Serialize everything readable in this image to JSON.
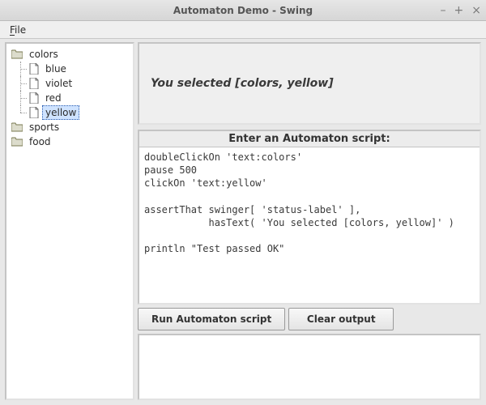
{
  "window": {
    "title": "Automaton Demo - Swing",
    "controls": {
      "minimize": "–",
      "maximize": "+",
      "close": "×"
    }
  },
  "menubar": {
    "file": {
      "label": "File",
      "underline_index": 0
    }
  },
  "tree": {
    "nodes": [
      {
        "kind": "folder",
        "label": "colors",
        "expanded": true,
        "level": 0
      },
      {
        "kind": "file",
        "label": "blue",
        "level": 1,
        "last": false
      },
      {
        "kind": "file",
        "label": "violet",
        "level": 1,
        "last": false
      },
      {
        "kind": "file",
        "label": "red",
        "level": 1,
        "last": false
      },
      {
        "kind": "file",
        "label": "yellow",
        "level": 1,
        "last": true,
        "selected": true
      },
      {
        "kind": "folder",
        "label": "sports",
        "expanded": false,
        "level": 0
      },
      {
        "kind": "folder",
        "label": "food",
        "expanded": false,
        "level": 0
      }
    ]
  },
  "status": {
    "text": "You selected [colors, yellow]"
  },
  "script": {
    "header": "Enter an Automaton script:",
    "body": "doubleClickOn 'text:colors'\npause 500\nclickOn 'text:yellow'\n\nassertThat swinger[ 'status-label' ],\n           hasText( 'You selected [colors, yellow]' )\n\nprintln \"Test passed OK\"\n"
  },
  "buttons": {
    "run": "Run Automaton script",
    "clear": "Clear output"
  },
  "output": {
    "text": ""
  }
}
